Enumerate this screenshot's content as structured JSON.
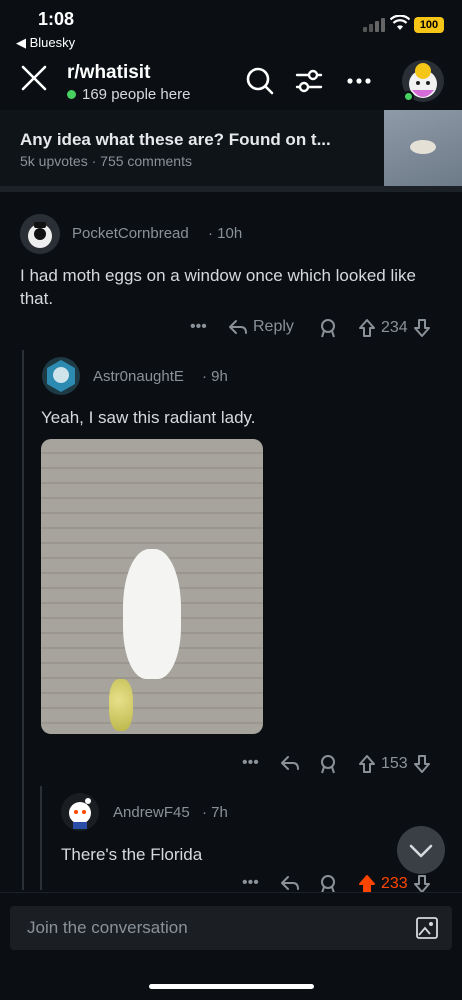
{
  "status": {
    "time": "1:08",
    "back_app": "◀ Bluesky",
    "battery": "100"
  },
  "header": {
    "subreddit": "r/whatisit",
    "online": "169 people here"
  },
  "post": {
    "title": "Any idea what these are? Found on t...",
    "meta": "5k upvotes · 755 comments"
  },
  "comments": [
    {
      "author": "PocketCornbread",
      "time": "· 10h",
      "text": "I had moth eggs on a window once which looked like that.",
      "reply_label": "Reply",
      "votes": "234"
    },
    {
      "author": "Astr0naughtE",
      "time": "· 9h",
      "text": "Yeah, I saw this radiant lady.",
      "votes": "153"
    },
    {
      "author": "AndrewF45",
      "time": "· 7h",
      "text": "There's the Florida",
      "votes": "233"
    }
  ],
  "composer": {
    "placeholder": "Join the conversation"
  },
  "colors": {
    "upvote_active": "#ff4500",
    "online": "#46d160",
    "battery": "#f5c518"
  }
}
